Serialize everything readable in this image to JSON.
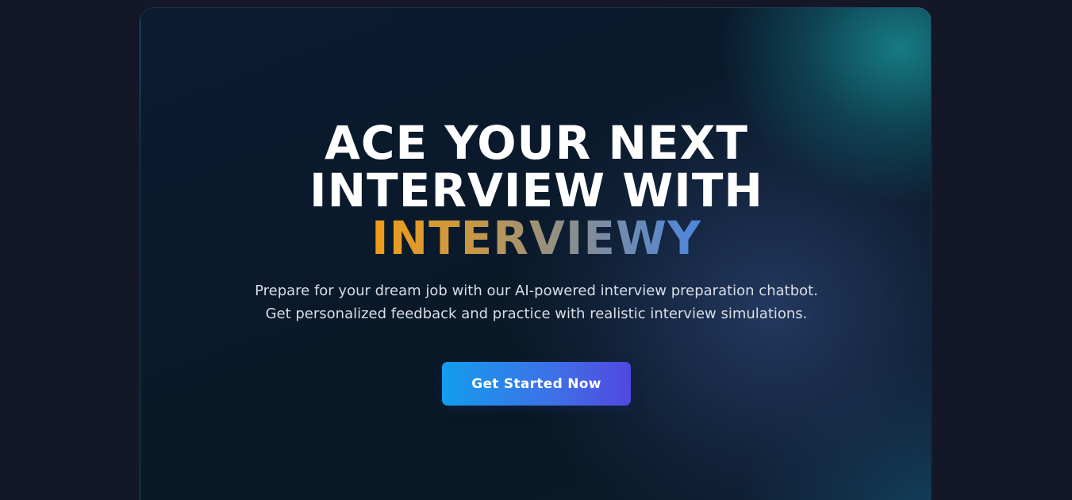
{
  "hero": {
    "headline_line1": "ACE YOUR NEXT",
    "headline_line2": "INTERVIEW WITH",
    "brand_name": "INTERVIEWY",
    "subtitle_line1": "Prepare for your dream job with our AI-powered interview preparation chatbot.",
    "subtitle_line2": "Get personalized feedback and practice with realistic interview simulations.",
    "cta_label": "Get Started Now"
  },
  "colors": {
    "page_background": "#131728",
    "brand_gradient_start": "#f29c16",
    "brand_gradient_end": "#4c86e0",
    "cta_gradient_start": "#139ded",
    "cta_gradient_end": "#5049e1"
  }
}
